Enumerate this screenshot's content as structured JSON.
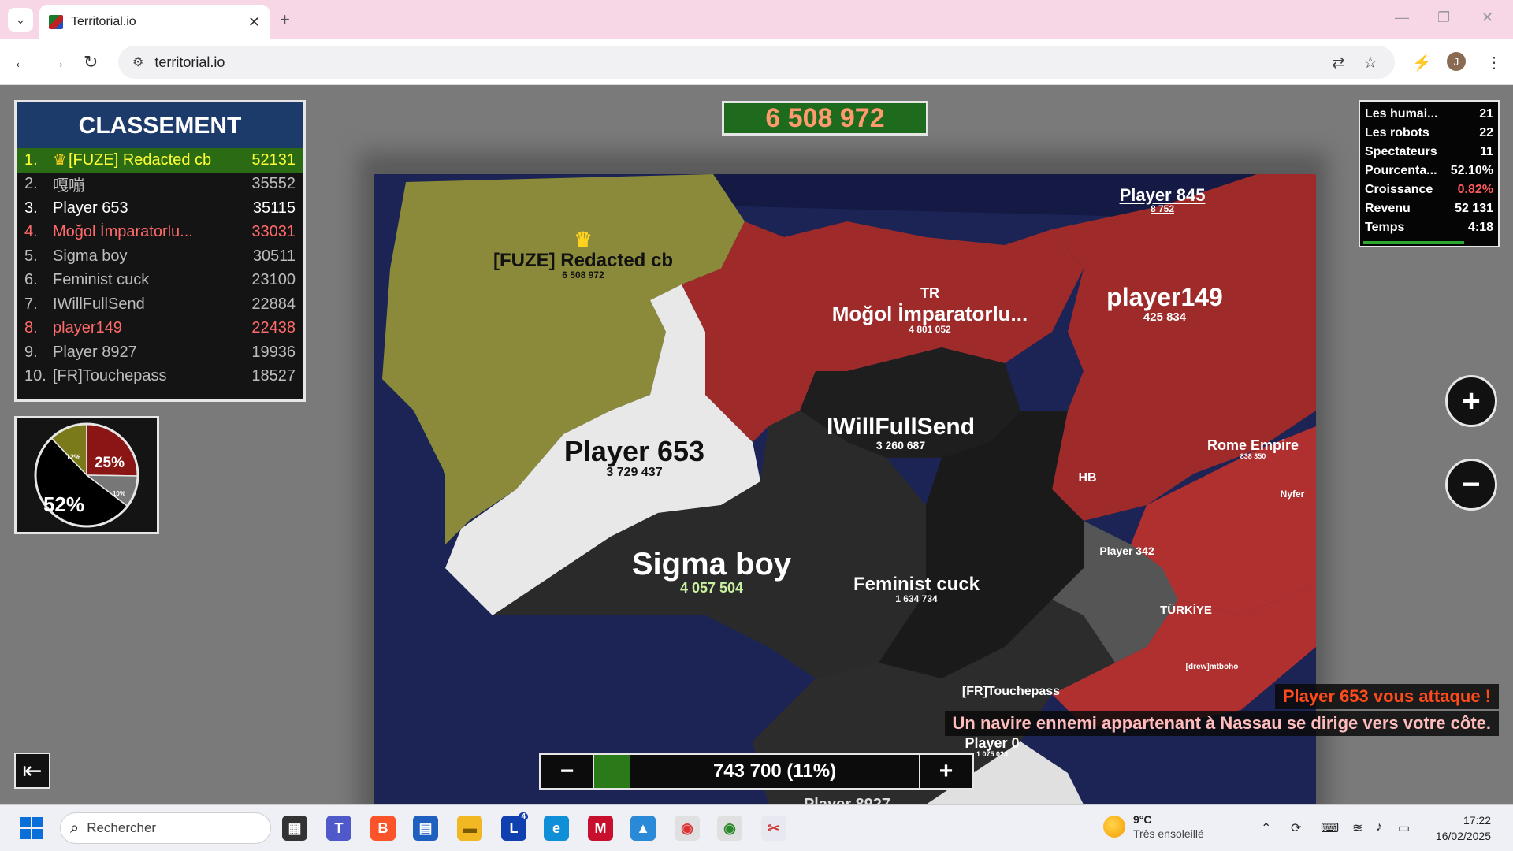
{
  "browser": {
    "tab_title": "Territorial.io",
    "url": "territorial.io",
    "avatar_letter": "J"
  },
  "game": {
    "top_score": "6 508 972",
    "leaderboard": {
      "title": "CLASSEMENT",
      "rows": [
        {
          "rank": "1.",
          "name": "[FUZE] Redacted cb",
          "score": "52131"
        },
        {
          "rank": "2.",
          "name": "嘎嘣",
          "score": "35552"
        },
        {
          "rank": "3.",
          "name": "Player 653",
          "score": "35115"
        },
        {
          "rank": "4.",
          "name": "Moğol İmparatorlu...",
          "score": "33031"
        },
        {
          "rank": "5.",
          "name": "Sigma boy",
          "score": "30511"
        },
        {
          "rank": "6.",
          "name": "Feminist cuck",
          "score": "23100"
        },
        {
          "rank": "7.",
          "name": "IWillFullSend",
          "score": "22884"
        },
        {
          "rank": "8.",
          "name": "player149",
          "score": "22438"
        },
        {
          "rank": "9.",
          "name": "Player 8927",
          "score": "19936"
        },
        {
          "rank": "10.",
          "name": "[FR]Touchepass",
          "score": "18527"
        }
      ]
    },
    "pie": {
      "slices": [
        {
          "label": "52%",
          "value": 52,
          "color": "#000000"
        },
        {
          "label": "12%",
          "value": 12,
          "color": "#7a7a1a"
        },
        {
          "label": "25%",
          "value": 25,
          "color": "#8a1515"
        },
        {
          "label": "10%",
          "value": 10,
          "color": "#777777"
        }
      ]
    },
    "stats": [
      {
        "label": "Les humai...",
        "value": "21"
      },
      {
        "label": "Les robots",
        "value": "22"
      },
      {
        "label": "Spectateurs",
        "value": "11"
      },
      {
        "label": "Pourcenta...",
        "value": "52.10%"
      },
      {
        "label": "Croissance",
        "value": "0.82%",
        "accent": true
      },
      {
        "label": "Revenu",
        "value": "52 131"
      },
      {
        "label": "Temps",
        "value": "4:18"
      }
    ],
    "zoom_in": "+",
    "zoom_out": "−",
    "troops": {
      "label": "743 700 (11%)",
      "minus": "−",
      "plus": "+",
      "percent": 11
    },
    "notifications": {
      "attack": "Player 653 vous attaque !",
      "ship": "Un navire ennemi appartenant à Nassau se dirige vers votre côte."
    },
    "territories": [
      {
        "name": "[FUZE] Redacted cb",
        "sub": "6 508 972",
        "crown": "♛"
      },
      {
        "name": "Player 845",
        "sub": "8 752"
      },
      {
        "name": "TR",
        "sub": ""
      },
      {
        "name": "Moğol İmparatorlu...",
        "sub": "4 801 052"
      },
      {
        "name": "player149",
        "sub": "425 834"
      },
      {
        "name": "IWillFullSend",
        "sub": "3 260 687"
      },
      {
        "name": "Player 653",
        "sub": "3 729 437"
      },
      {
        "name": "Rome Empire",
        "sub": "838 350"
      },
      {
        "name": "HB",
        "sub": ""
      },
      {
        "name": "Nyfer",
        "sub": ""
      },
      {
        "name": "Sigma boy",
        "sub": "4 057 504"
      },
      {
        "name": "Feminist cuck",
        "sub": "1 634 734"
      },
      {
        "name": "Player 342",
        "sub": ""
      },
      {
        "name": "TÜRKİYE",
        "sub": ""
      },
      {
        "name": "[drew]mtboho",
        "sub": ""
      },
      {
        "name": "[FR]Touchepass",
        "sub": ""
      },
      {
        "name": "Player 0",
        "sub": "1 075 023"
      },
      {
        "name": "Player 8927",
        "sub": ""
      }
    ]
  },
  "taskbar": {
    "search_placeholder": "Rechercher",
    "weather_temp": "9°C",
    "weather_desc": "Très ensoleillé",
    "time": "17:22",
    "date": "16/02/2025",
    "badge": "4"
  }
}
